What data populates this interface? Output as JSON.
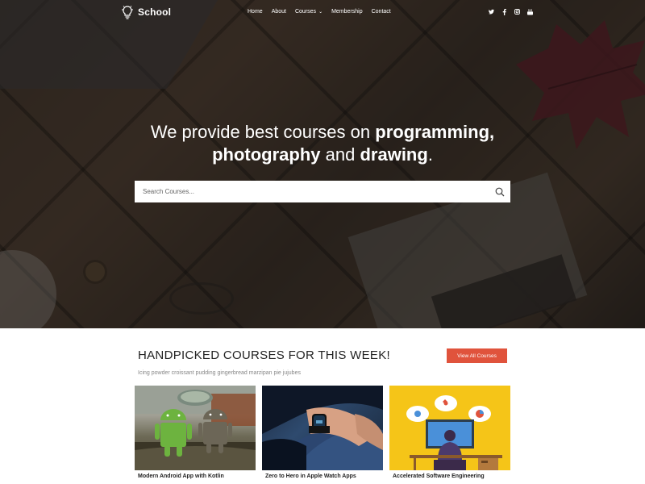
{
  "nav": {
    "logo": "School",
    "menu": [
      {
        "label": "Home"
      },
      {
        "label": "About"
      },
      {
        "label": "Courses",
        "has_dropdown": true
      },
      {
        "label": "Membership"
      },
      {
        "label": "Contact"
      }
    ],
    "social": [
      "twitter-icon",
      "facebook-icon",
      "instagram-icon",
      "youtube-icon"
    ]
  },
  "hero": {
    "line1_light": "We provide best courses on",
    "line1_bold": "programming,",
    "line2_bold1": "photography",
    "line2_light": "and",
    "line2_bold2": "drawing",
    "line2_end": "."
  },
  "search": {
    "placeholder": "Search Courses...",
    "value": ""
  },
  "section": {
    "title": "HANDPICKED COURSES FOR THIS WEEK!",
    "subtitle": "Icing powder croissant pudding gingerbread marzipan pie jujubes",
    "view_all_label": "View All Courses"
  },
  "courses": [
    {
      "title": "Modern Android App with Kotlin"
    },
    {
      "title": "Zero to Hero in Apple Watch Apps"
    },
    {
      "title": "Accelerated Software Engineering"
    }
  ],
  "colors": {
    "accent": "#e0533c",
    "text_dark": "#222222",
    "card3_bg": "#f5c518"
  }
}
